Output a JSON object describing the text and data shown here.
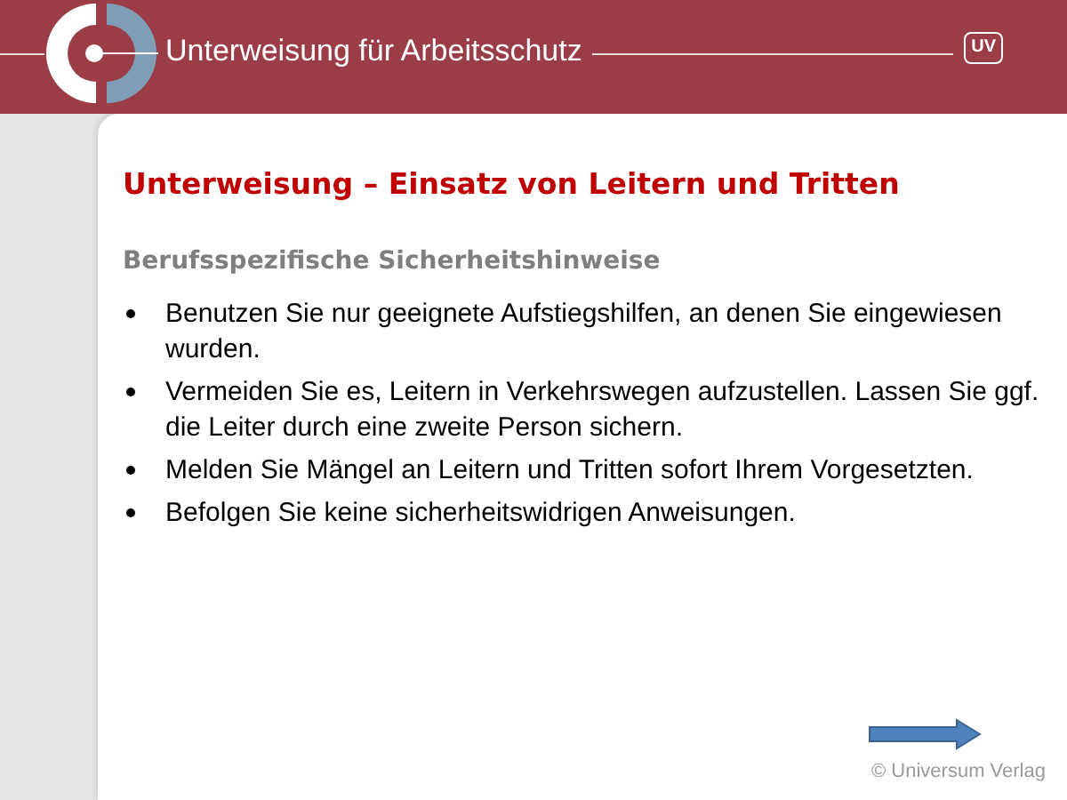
{
  "header": {
    "title": "Unterweisung für Arbeitsschutz",
    "badge": "UV"
  },
  "slide": {
    "title": "Unterweisung – Einsatz von Leitern und Tritten",
    "subtitle": "Berufsspezifische Sicherheitshinweise",
    "bullets": [
      "Benutzen Sie nur geeignete Aufstiegshilfen, an denen Sie eingewiesen wurden.",
      "Vermeiden Sie es, Leitern in Verkehrswegen aufzustellen. Lassen Sie ggf. die Leiter durch eine zweite Person sichern.",
      "Melden Sie Mängel an Leitern und Tritten sofort Ihrem Vorgesetzten.",
      "Befolgen Sie keine sicherheitswidrigen Anweisungen."
    ]
  },
  "footer": {
    "copyright": "© Universum Verlag"
  }
}
